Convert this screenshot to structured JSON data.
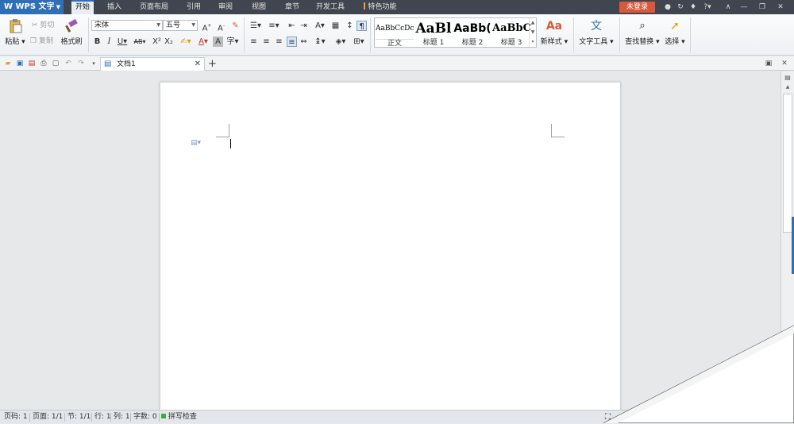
{
  "app": {
    "name": "WPS 文字"
  },
  "menu_tabs": [
    "开始",
    "插入",
    "页面布局",
    "引用",
    "审阅",
    "视图",
    "章节",
    "开发工具",
    "特色功能"
  ],
  "login_label": "未登录",
  "clipboard": {
    "paste": "粘贴",
    "cut": "剪切",
    "copy": "复制",
    "format_painter": "格式刷"
  },
  "font": {
    "name": "宋体",
    "size": "五号"
  },
  "styles": [
    {
      "sample": "AaBbCcDc",
      "label": "正文"
    },
    {
      "sample": "AaBl",
      "label": "标题 1"
    },
    {
      "sample": "AaBb(",
      "label": "标题 2"
    },
    {
      "sample": "AaBbC",
      "label": "标题 3"
    }
  ],
  "ribbon_buttons": {
    "new_style": "新样式",
    "text_tools": "文字工具",
    "find_replace": "查找替换",
    "select": "选择"
  },
  "document_tab": {
    "title": "文档1"
  },
  "statusbar": {
    "page_num": "页码: 1",
    "pages": "页面: 1/1",
    "section": "节: 1/1",
    "row": "行: 1",
    "col": "列: 1",
    "word_count": "字数: 0",
    "spell_check": "拼写检查"
  },
  "colors": {
    "accent": "#2f6fb5",
    "login_bg": "#d9583b",
    "titlebar_bg": "#40464f"
  }
}
